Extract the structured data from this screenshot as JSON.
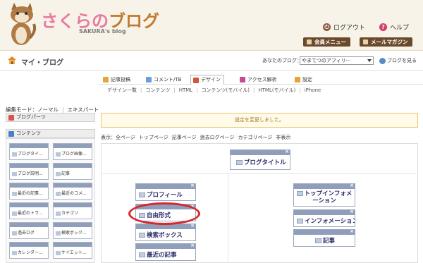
{
  "header": {
    "logo_main": "さくらの",
    "logo_accent": "ブログ",
    "logo_sub": "SAKURA's blog",
    "logout": "ログアウト",
    "help": "ヘルプ",
    "member_menu": "会員メニュー",
    "mail_magazine": "メールマガジン",
    "colors": {
      "logo_pink": "#e87aa0",
      "logo_brown": "#c17a2e",
      "menu_brown": "#6b4a2b"
    }
  },
  "myblog": {
    "title": "マイ・ブログ",
    "your_blog_label": "あなたのブログ：",
    "selected_blog": "やまてつのアフィリ···",
    "view_blog": "ブログを見る"
  },
  "tabs": [
    {
      "label": "記事投稿",
      "icon": "pencil-icon"
    },
    {
      "label": "コメント/TB",
      "icon": "comment-icon"
    },
    {
      "label": "デザイン",
      "icon": "design-icon",
      "active": true
    },
    {
      "label": "アクセス解析",
      "icon": "chart-icon"
    },
    {
      "label": "設定",
      "icon": "settings-icon"
    }
  ],
  "subnav": [
    "デザイン一覧",
    "コンテンツ",
    "HTML",
    "コンテンツ(モバイル)",
    "HTML(モバイル)",
    "iPhone"
  ],
  "left": {
    "edit_mode_label": "編集モード：",
    "edit_mode_normal": "ノーマル",
    "edit_mode_expert": "エキスパート",
    "blog_parts": "ブログパーツ",
    "contents": "コンテンツ",
    "parts": [
      "ブログタイ...",
      "ブログ画像...",
      "ブログ説明...",
      "記事",
      "最近の記事...",
      "最近のコメ...",
      "最近のトラ...",
      "カテゴリ",
      "過去ログ",
      "検索ボック...",
      "カレンダー...",
      "ケイエット..."
    ]
  },
  "main": {
    "notice": "設定を変更しました。",
    "display_label": "表示：",
    "display_links": [
      "全ページ",
      "トップページ",
      "記事ページ",
      "過去ログページ",
      "カテゴリページ",
      "非表示"
    ],
    "widgets": {
      "blog_title": "ブログタイトル",
      "profile": "プロフィール",
      "free_format": "自由形式",
      "search_box": "検索ボックス",
      "recent_articles": "最近の記事",
      "top_information": "トップインフォメーション",
      "information": "インフォメーション",
      "article": "記事"
    },
    "close_mark": "×"
  }
}
